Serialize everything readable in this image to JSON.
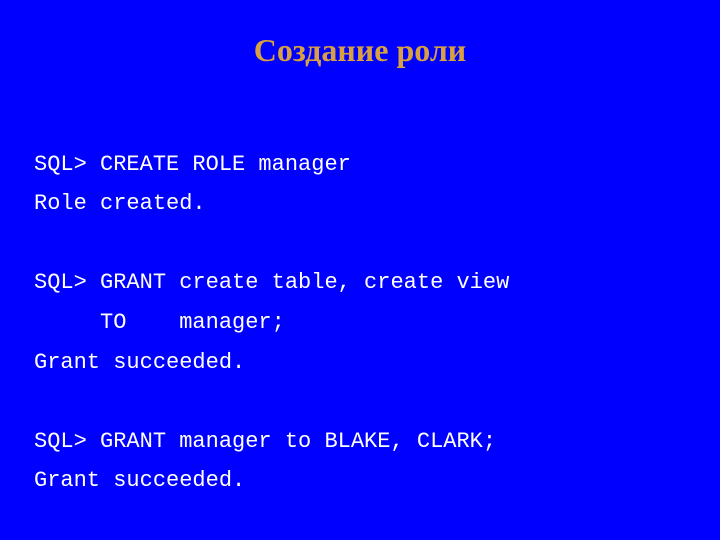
{
  "title": "Создание роли",
  "code": {
    "l1": "SQL> CREATE ROLE manager",
    "l2": "Role created.",
    "blank1": "",
    "l3": "SQL> GRANT create table, create view",
    "l4": "     TO    manager;",
    "l5": "Grant succeeded.",
    "blank2": "",
    "l6": "SQL> GRANT manager to BLAKE, CLARK;",
    "l7": "Grant succeeded."
  }
}
